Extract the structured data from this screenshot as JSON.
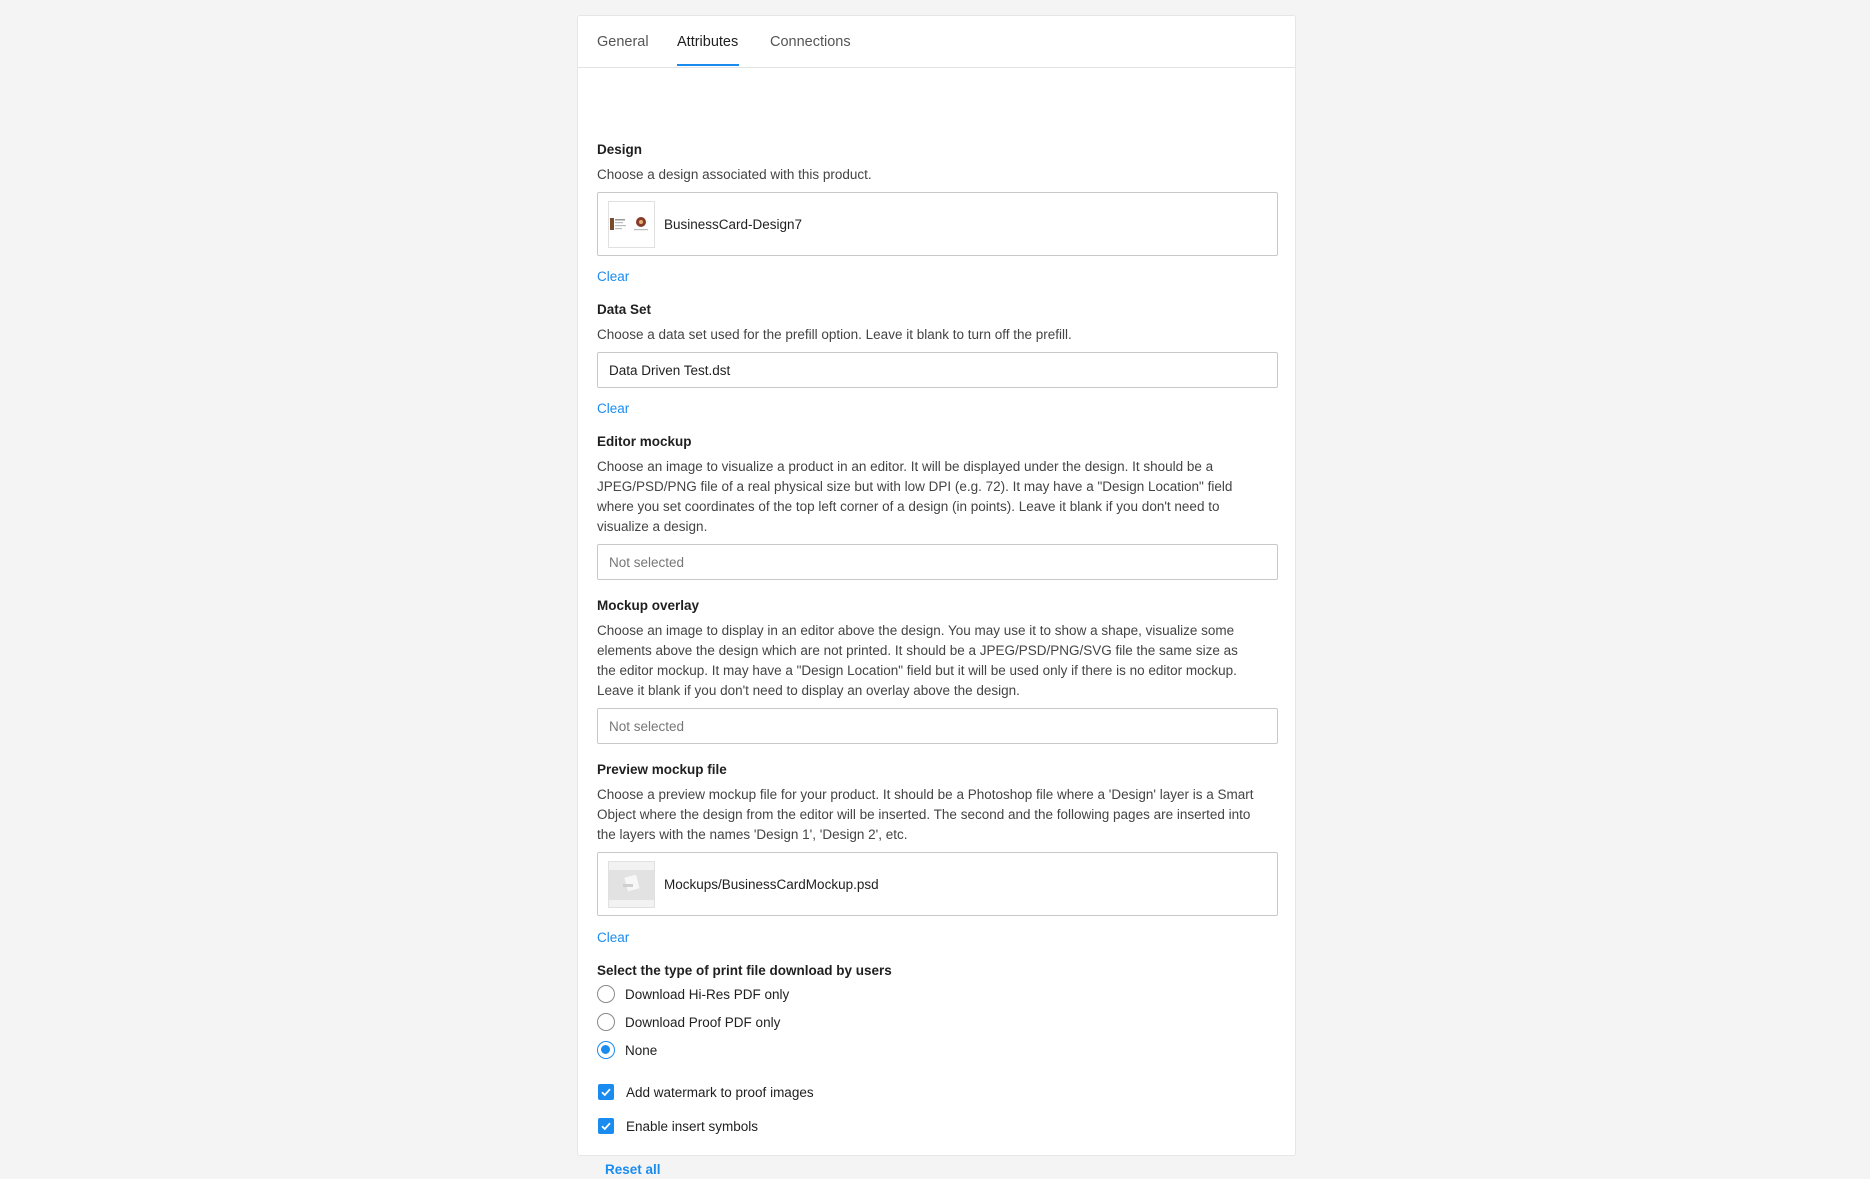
{
  "tabs": [
    {
      "label": "General",
      "active": false
    },
    {
      "label": "Attributes",
      "active": true
    },
    {
      "label": "Connections",
      "active": false
    }
  ],
  "design": {
    "title": "Design",
    "description": "Choose a design associated with this product.",
    "value": "BusinessCard-Design7",
    "thumb_icon": "business-card-thumbnail",
    "clear_label": "Clear"
  },
  "dataset": {
    "title": "Data Set",
    "description": "Choose a data set used for the prefill option. Leave it blank to turn off the prefill.",
    "value": "Data Driven Test.dst",
    "clear_label": "Clear"
  },
  "editor_mockup": {
    "title": "Editor mockup",
    "description_lines": [
      "Choose an image to visualize a product in an editor. It will be displayed under the design. It should be a",
      "JPEG/PSD/PNG file of a real physical size but with low DPI (e.g. 72). It may have a \"Design Location\" field",
      "where you set coordinates of the top left corner of a design (in points). Leave it blank if you don't need to",
      "visualize a design."
    ],
    "placeholder": "Not selected"
  },
  "mockup_overlay": {
    "title": "Mockup overlay",
    "description_lines": [
      "Choose an image to display in an editor above the design. You may use it to show a shape, visualize some",
      "elements above the design which are not printed. It should be a JPEG/PSD/PNG/SVG file the same size as",
      "the editor mockup. It may have a \"Design Location\" field but it will be used only if there is no editor mockup.",
      "Leave it blank if you don't need to display an overlay above the design."
    ],
    "placeholder": "Not selected"
  },
  "preview_mockup": {
    "title": "Preview mockup file",
    "description_lines": [
      "Choose a preview mockup file for your product. It should be a Photoshop file where a 'Design' layer is a Smart",
      "Object where the design from the editor will be inserted. The second and the following pages are inserted into",
      "the layers with the names 'Design 1', 'Design 2', etc."
    ],
    "value": "Mockups/BusinessCardMockup.psd",
    "thumb_icon": "mockup-thumbnail",
    "clear_label": "Clear"
  },
  "print_download": {
    "title": "Select the type of print file download by users",
    "options": [
      {
        "label": "Download Hi-Res PDF only",
        "checked": false
      },
      {
        "label": "Download Proof PDF only",
        "checked": false
      },
      {
        "label": "None",
        "checked": true
      }
    ]
  },
  "checkboxes": [
    {
      "label": "Add watermark to proof images",
      "checked": true
    },
    {
      "label": "Enable insert symbols",
      "checked": true
    }
  ],
  "reset_label": "Reset all",
  "colors": {
    "accent": "#1a8cf0",
    "background": "#f4f4f4",
    "card": "#ffffff"
  }
}
